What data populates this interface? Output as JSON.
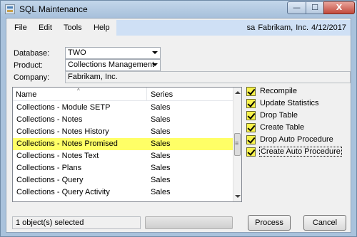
{
  "window": {
    "title": "SQL Maintenance"
  },
  "window_controls": {
    "minimize": "—",
    "maximize": "☐",
    "close": "X"
  },
  "menu": {
    "file": "File",
    "edit": "Edit",
    "tools": "Tools",
    "help": "Help"
  },
  "user_info": "sa  Fabrikam, Inc.  4/12/2017",
  "form": {
    "database_label": "Database:",
    "database_value": "TWO",
    "product_label": "Product:",
    "product_value": "Collections Management",
    "company_label": "Company:",
    "company_value": "Fabrikam, Inc."
  },
  "list": {
    "columns": {
      "name": "Name",
      "series": "Series",
      "sort_indicator": "^"
    },
    "rows": [
      {
        "name": "Collections - Module SETP",
        "series": "Sales"
      },
      {
        "name": "Collections - Notes",
        "series": "Sales"
      },
      {
        "name": "Collections - Notes History",
        "series": "Sales"
      },
      {
        "name": "Collections - Notes Promised",
        "series": "Sales",
        "selected": true
      },
      {
        "name": "Collections - Notes Text",
        "series": "Sales"
      },
      {
        "name": "Collections - Plans",
        "series": "Sales"
      },
      {
        "name": "Collections - Query",
        "series": "Sales"
      },
      {
        "name": "Collections - Query Activity",
        "series": "Sales"
      }
    ]
  },
  "options": [
    {
      "label": "Recompile",
      "checked": true
    },
    {
      "label": "Update Statistics",
      "checked": true
    },
    {
      "label": "Drop Table",
      "checked": true
    },
    {
      "label": "Create Table",
      "checked": true
    },
    {
      "label": "Drop Auto Procedure",
      "checked": true
    },
    {
      "label": "Create Auto Procedure",
      "checked": true,
      "focused": true
    }
  ],
  "status": {
    "text": "1 object(s) selected"
  },
  "buttons": {
    "process": "Process",
    "cancel": "Cancel"
  },
  "colors": {
    "selection_highlight": "#ffff66",
    "checkbox_fill": "#f7f24a",
    "user_bar": "#cfe0f5"
  }
}
